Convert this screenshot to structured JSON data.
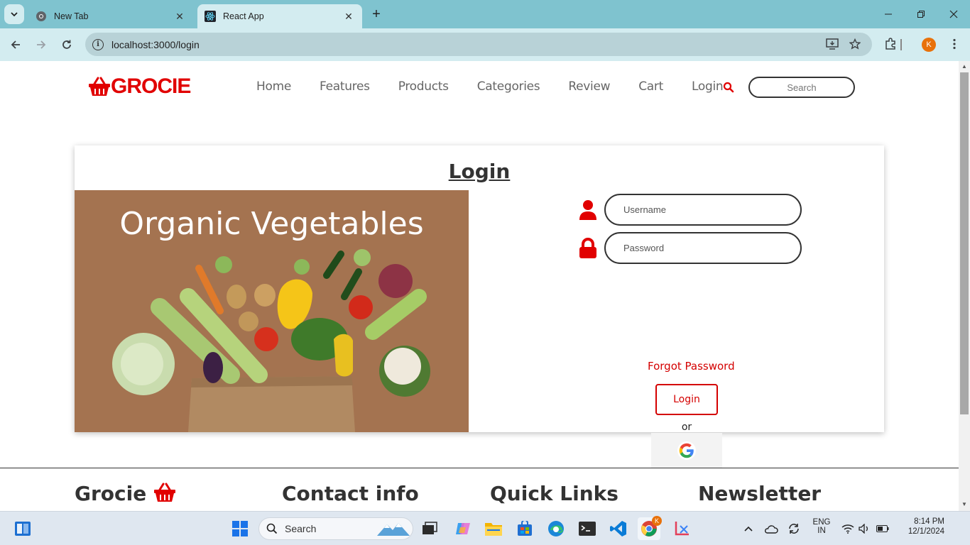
{
  "browser": {
    "tabs": [
      {
        "title": "New Tab",
        "active": false
      },
      {
        "title": "React App",
        "active": true
      }
    ],
    "url": "localhost:3000/login",
    "profile_initial": "K"
  },
  "site": {
    "logo": "GROCIE",
    "nav": [
      "Home",
      "Features",
      "Products",
      "Categories",
      "Review",
      "Cart",
      "Login"
    ],
    "search_placeholder": "Search"
  },
  "login": {
    "title": "Login",
    "hero_text": "Organic Vegetables",
    "username_placeholder": "Username",
    "password_placeholder": "Password",
    "forgot": "Forgot Password",
    "button": "Login",
    "or": "or"
  },
  "footer": {
    "headings": [
      "Grocie",
      "Contact info",
      "Quick Links",
      "Newsletter"
    ]
  },
  "taskbar": {
    "search_label": "Search",
    "lang_top": "ENG",
    "lang_bottom": "IN",
    "time": "8:14 PM",
    "date": "12/1/2024"
  },
  "colors": {
    "brand": "#e10000",
    "chrome": "#7fc3cf",
    "chrome_light": "#d3ecf0"
  }
}
